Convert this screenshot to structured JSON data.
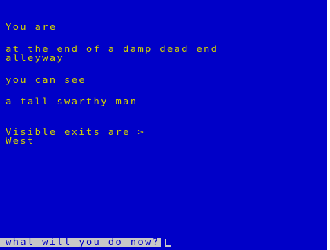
{
  "game": {
    "location_header": "You are",
    "location_lines": [
      "at the end of a damp dead end",
      "alleyway"
    ],
    "objects_header": "you can see",
    "objects": [
      "a tall swarthy man"
    ],
    "exits_header": "Visible exits are >",
    "exits": [
      "West"
    ],
    "prompt": "what will you do now?"
  },
  "colors": {
    "background": "#0000c8",
    "text": "#d0d000",
    "prompt_background": "#c8c8c8",
    "prompt_text": "#0000c8"
  }
}
